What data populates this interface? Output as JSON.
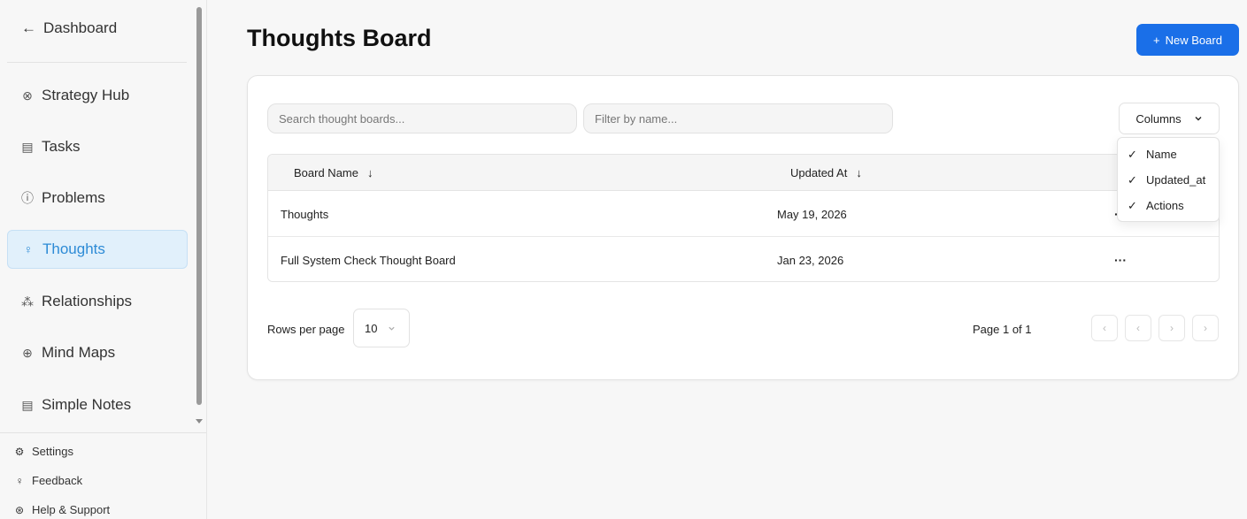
{
  "sidebar": {
    "back_label": "Dashboard",
    "items": [
      {
        "label": "Strategy Hub",
        "icon": "strategy-icon"
      },
      {
        "label": "Tasks",
        "icon": "clipboard-icon"
      },
      {
        "label": "Problems",
        "icon": "alert-circle-icon"
      },
      {
        "label": "Thoughts",
        "icon": "lightbulb-icon",
        "active": true
      },
      {
        "label": "Relationships",
        "icon": "network-icon"
      },
      {
        "label": "Mind Maps",
        "icon": "brain-icon"
      },
      {
        "label": "Simple Notes",
        "icon": "note-icon"
      }
    ],
    "footer": [
      {
        "label": "Settings",
        "icon": "gear-icon"
      },
      {
        "label": "Feedback",
        "icon": "lightbulb-icon"
      },
      {
        "label": "Help & Support",
        "icon": "lifebuoy-icon"
      }
    ]
  },
  "header": {
    "title": "Thoughts Board",
    "new_board_label": "New Board"
  },
  "toolbar": {
    "search_placeholder": "Search thought boards...",
    "filter_placeholder": "Filter by name...",
    "columns_label": "Columns"
  },
  "columns_menu": {
    "items": [
      "Name",
      "Updated_at",
      "Actions"
    ]
  },
  "table": {
    "headers": {
      "name": "Board Name",
      "updated": "Updated At"
    },
    "rows": [
      {
        "name": "Thoughts",
        "updated": "May 19, 2026",
        "actions": "···"
      },
      {
        "name": "Full System Check Thought Board",
        "updated": "Jan 23, 2026",
        "actions": "···"
      }
    ]
  },
  "pagination": {
    "rows_per_page_label": "Rows per page",
    "rows_per_page_value": "10",
    "page_info": "Page 1 of 1"
  },
  "colors": {
    "accent": "#1a6fe8",
    "active_bg": "#e1f0fb",
    "active_text": "#2d8bd6"
  }
}
